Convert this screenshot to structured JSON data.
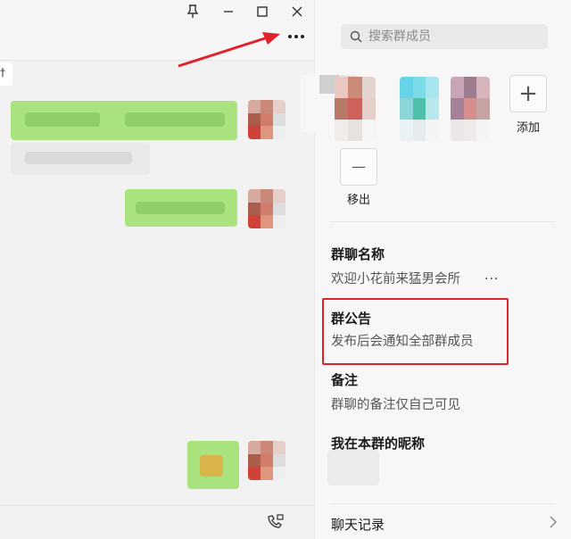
{
  "window_controls": {
    "pin_icon": "pin-icon",
    "minimize_icon": "minimize-icon",
    "maximize_icon": "maximize-icon",
    "close_icon": "close-icon",
    "more_icon": "more-icon"
  },
  "chat": {
    "left_edge_glyph": "†"
  },
  "panel": {
    "search": {
      "placeholder": "搜索群成员"
    },
    "add_label": "添加",
    "remove_label": "移出",
    "add_glyph": "+",
    "remove_glyph": "—",
    "group_name": {
      "title": "群聊名称",
      "value": "欢迎小花前来猛男会所",
      "more": "..."
    },
    "announcement": {
      "title": "群公告",
      "value": "发布后会通知全部群成员"
    },
    "remark": {
      "title": "备注",
      "value": "群聊的备注仅自己可见"
    },
    "nickname": {
      "title": "我在本群的昵称"
    },
    "history": {
      "label": "聊天记录"
    }
  },
  "colors": {
    "annotation_red": "#e0222c",
    "bubble_green": "#a9e37d"
  }
}
